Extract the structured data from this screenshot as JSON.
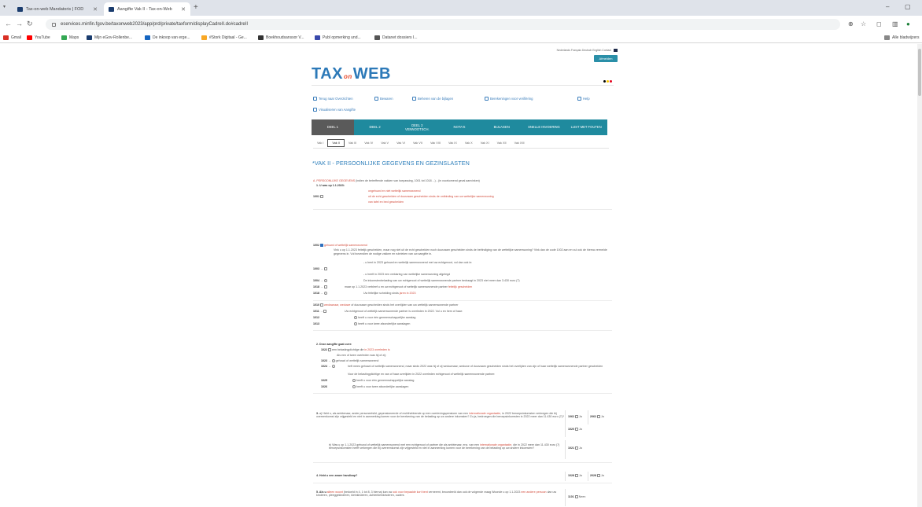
{
  "browser": {
    "tabs": [
      {
        "title": "Tax-on-web Mandatoris | FOD",
        "active": false
      },
      {
        "title": "Aangifte Vak II - Tax-on-Web",
        "active": true
      }
    ],
    "url": "eservices.minfin.fgov.be/taxonweb2023/app/prd/private/taxform/displayCadreII.do#cadreII",
    "bookmarks": [
      {
        "label": "Gmail",
        "color": "#d93025"
      },
      {
        "label": "YouTube",
        "color": "#ff0000"
      },
      {
        "label": "Maps",
        "color": "#34a853"
      },
      {
        "label": "Mijn eGov-Rollenbe...",
        "color": "#1a3c6e"
      },
      {
        "label": "De inkoop van erge...",
        "color": "#1565c0"
      },
      {
        "label": "#Stork Digitaal - Ge...",
        "color": "#f9a825"
      },
      {
        "label": "Boekhoudsanssor V...",
        "color": "#333333"
      },
      {
        "label": "Publ opmerking und...",
        "color": "#3949ab"
      },
      {
        "label": "Datanet dossiers I...",
        "color": "#555555"
      }
    ],
    "bookmarks_right": "Alle bladwijzers"
  },
  "site": {
    "top_links": "Nederlands  Français  Deutsch  English  Contact",
    "login_button": "Afmelden",
    "logo_part1": "TAX",
    "logo_part2": "on",
    "logo_part3": "WEB",
    "flag_colors": [
      "#000000",
      "#f5c400",
      "#e3001b"
    ],
    "brand_color": "#2c79b8",
    "accent_color": "#1f8a9e"
  },
  "actions": {
    "back_overview": "Terug naar Overzichten",
    "save": "Bewaren",
    "attachments": "Beheren van de bijlagen",
    "calculation": "Berekeningen voor verifiëring",
    "help": "Help",
    "view_form": "Visualiseren van Aangifte"
  },
  "nav": {
    "tabs": [
      "DEEL 1",
      "DEEL 2",
      "DEEL 2\nVENNOOTSCH.",
      "NOTA'S",
      "BIJLAGEN",
      "SNELLE INVOERING",
      "LIJST MET FOUTEN"
    ]
  },
  "subtabs": [
    "Vak I",
    "Vak II",
    "Vak III",
    "Vak IV",
    "Vak V",
    "Vak VI",
    "Vak VII",
    "Vak VIII",
    "Vak IX",
    "Vak X",
    "Vak XI",
    "Vak XII",
    "Vak XIII"
  ],
  "vak_title": "*VAK II - PERSOONLIJKE GEGEVENS EN GEZINSLASTEN",
  "sectionA": {
    "header": "A. PERSOONLIJKE GEGEVENS",
    "header_rest": " (indien de betreffende vakken van toepassing, 1001 tot 1018 ...) - (in voorkomend geval aanvinken)",
    "q1": "1. U was op 1.1.2023:",
    "opt1": "ongehuwd en niet wettelijk samenwonend",
    "opt2": "uit de echt gescheiden of duurzaam gescheiden sinds de ontbinding van uw wettelijke samenwoning",
    "opt3": "van tafel en bed gescheiden",
    "code1001": "1001",
    "code1002": "1002",
    "married": "gehuwd of wettelijk samenwonend",
    "married_note": "Vink u op 1.1.2023 feitelijk gescheiden, maar nog niet uit de echt gescheiden noch duurzaam gescheiden sinds de beëindiging van de wettelijke samenwoning? Vink dan de code 1002 aan en vul ook de hierna vermelde gegevens in. Vul bovendien de nodige vakken en rubrieken van uw aangifte in.",
    "line_a": "- u bent in 2023 gehuwd en wettelijk samenwonend met uw echtgenoot, vul dan ook in:",
    "code1003": "1003",
    "line_b": "- u heeft in 2023 een verklaring van wettelijke samenwoning afgelegd",
    "code1004": "1004",
    "line_c": "De inkomstenbelasting van uw echtgenoot of wettelijk samenwonende partner bedraagt in 2023 niet meer dan 3.430 euro (7)",
    "code1018a": "1018",
    "line_d": "maar op 1.1.2023 verbleef u en uw echtgenoot of wettelijk samenwonende partner",
    "line_d_red": "feitelijk gescheiden",
    "code1018b": "1018",
    "line_e": "Uw feitelijke scheiding sinds",
    "line_e_red": "jaren in 2023",
    "code1010": "1010",
    "widow": "weduwnaar, weduwe",
    "widow_rest": "of duurzaam gescheiden sinds het overlijden van uw wettelijk samenwonende partner",
    "code1011": "1011",
    "widow_line": "Uw echtgenoot of wettelijk samenwonende partner is overleden in 2022. Vul u en hem of haar:",
    "code1012": "1012",
    "w_opt1": "heeft u voor één gemeenschappelijke aanslag",
    "code1013": "1013",
    "w_opt2": "heeft u voor twee afzonderlijke aanslagen"
  },
  "sectionA2": {
    "q2": "2. Deze aangifte gaat over:",
    "code1022": "1022",
    "l1a": "een belastingplichtige die",
    "l1_red": "in 2023 overleden is",
    "l1b": "Als een of twee overleden was hij of zij:",
    "code1023": "1023",
    "l2": "gehuwd of wettelijk samenwonend",
    "code1024": "1024",
    "l3": "heft mees gehuwd of wettelijk samenwonend, maar sinds 2022 was hij of zij weduwnaar, weduwe of duurzaam gescheiden sinds het overlijden van zijn of haar wettelijk samenwonende partner gescheiden",
    "l3b": "Voor de belastingplichtige en van of haar overlijden in 2022 overleden echtgenoot of wettelijk samenwonende partner:",
    "code1025": "1025",
    "l4": "heeft u voor één gemeenschappelijke aanslag",
    "code1026": "1026",
    "l5": "heeft u voor twee afzonderlijke aanslagen"
  },
  "sectionA3": {
    "q3": "3.",
    "q3a": "a) Hebt u, als ambtenaar, ander personeelslid, gepensioneerde of rechthebbende op een overlevingspensioen van een",
    "q3a_red": "internationale organisatie",
    "q3a_rest": ", in 2022 beroepsinkomsten verkregen die bij overeenkomst zijn vrijgesteld en niet in aanmerking komen voor de berekening van de belasting op uw andere inkomsten?",
    "q3a_last": "Zo ja, bedroegen die beroepsinkomsten in 2022 meer dan 11.430 euro (7)?",
    "c1062": "1062",
    "c2062": "2062",
    "c1020": "1020",
    "ja": "Ja",
    "q3b": "b) Was u op 1.1.2023 gehuwd of wettelijk samenwonend met een echtgenoot of partner die als ambtenaar, enz. van een",
    "q3b_red": "internationale organisatie",
    "q3b_rest": ", die in 2022 meer dan 11.430 euro (7) beroepsinkomsten heeft verkregen die bij overeenkomst zijn vrijgesteld en niet in aanmerking komen voor de berekening van de belasting op uw andere inkomsten?",
    "c1021": "1021"
  },
  "sectionA4": {
    "q4": "4. Hebt u een zware handicap?",
    "c1028": "1028",
    "c2028": "2028"
  },
  "sectionA5": {
    "q5a": "5. Als u",
    "q5_red": "alleen woont",
    "q5b": "(bedoeld in 4, 1 tot 8, 3 hierna) kan uw",
    "q5_red2": "ook voor bepaalde kort bent",
    "q5c": "verneemt, beoordeeld dan ook de volgende vraag",
    "q5d": "Woonde u op 1.1.2023",
    "q5_red3": "een andere persoon",
    "q5e": "dan uw kinderen, pleeggekinderen, kleinkinderen, achterkleinkinderen, ouders",
    "c1101": "1101",
    "neen": "Neen"
  }
}
